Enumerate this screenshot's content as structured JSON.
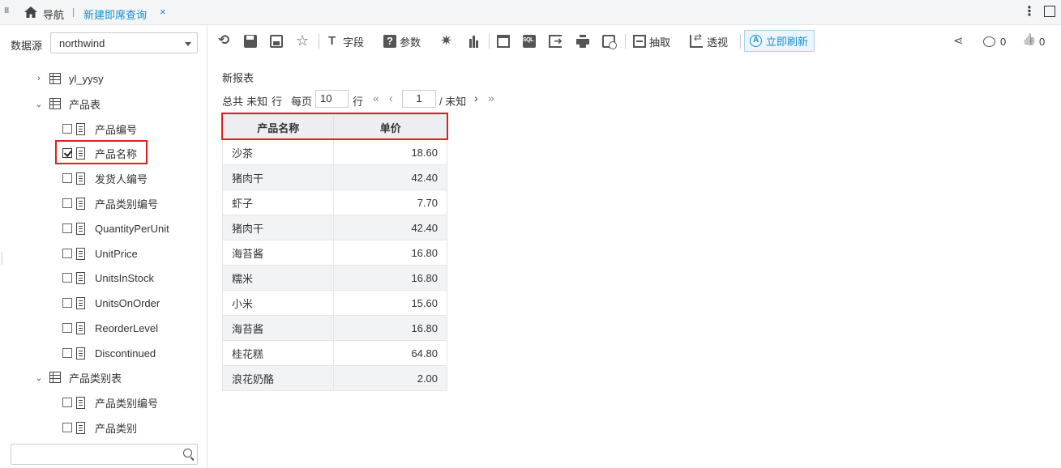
{
  "topbar": {
    "grip": "III",
    "home_icon": "home-icon",
    "nav_label": "导航",
    "active_tab": "新建即席查询",
    "close_glyph": "×"
  },
  "sidebar": {
    "datasource_label": "数据源",
    "datasource_value": "northwind",
    "tree": [
      {
        "type": "table",
        "expanded": false,
        "label": "yl_yysy"
      },
      {
        "type": "table",
        "expanded": true,
        "label": "产品表"
      },
      {
        "type": "field",
        "checked": false,
        "label": "产品编号"
      },
      {
        "type": "field",
        "checked": true,
        "label": "产品名称"
      },
      {
        "type": "field",
        "checked": false,
        "label": "发货人编号"
      },
      {
        "type": "field",
        "checked": false,
        "label": "产品类别编号"
      },
      {
        "type": "field",
        "checked": false,
        "label": "QuantityPerUnit"
      },
      {
        "type": "field",
        "checked": false,
        "label": "UnitPrice"
      },
      {
        "type": "field",
        "checked": false,
        "label": "UnitsInStock"
      },
      {
        "type": "field",
        "checked": false,
        "label": "UnitsOnOrder"
      },
      {
        "type": "field",
        "checked": false,
        "label": "ReorderLevel"
      },
      {
        "type": "field",
        "checked": false,
        "label": "Discontinued"
      },
      {
        "type": "table",
        "expanded": true,
        "label": "产品类别表"
      },
      {
        "type": "field",
        "checked": false,
        "label": "产品类别编号"
      },
      {
        "type": "field",
        "checked": false,
        "label": "产品类别"
      }
    ],
    "search_placeholder": ""
  },
  "toolbar": {
    "field_label": "字段",
    "param_label": "参数",
    "extract_label": "抽取",
    "pivot_label": "透视",
    "refresh_label": "立即刷新",
    "comment_count": "0",
    "like_count": "0"
  },
  "report": {
    "title": "新报表",
    "total_label": "总共",
    "total_value": "未知",
    "rows_unit": "行",
    "per_page_label": "每页",
    "per_page_value": "10",
    "per_page_unit": "行",
    "current_page": "1",
    "page_total": "/ 未知",
    "columns": [
      "产品名称",
      "单价"
    ],
    "rows": [
      [
        "沙茶",
        "18.60"
      ],
      [
        "猪肉干",
        "42.40"
      ],
      [
        "虾子",
        "7.70"
      ],
      [
        "猪肉干",
        "42.40"
      ],
      [
        "海苔酱",
        "16.80"
      ],
      [
        "糯米",
        "16.80"
      ],
      [
        "小米",
        "15.60"
      ],
      [
        "海苔酱",
        "16.80"
      ],
      [
        "桂花糕",
        "64.80"
      ],
      [
        "浪花奶酪",
        "2.00"
      ]
    ]
  },
  "colors": {
    "accent": "#1a8bd1",
    "highlight": "#e02020"
  }
}
